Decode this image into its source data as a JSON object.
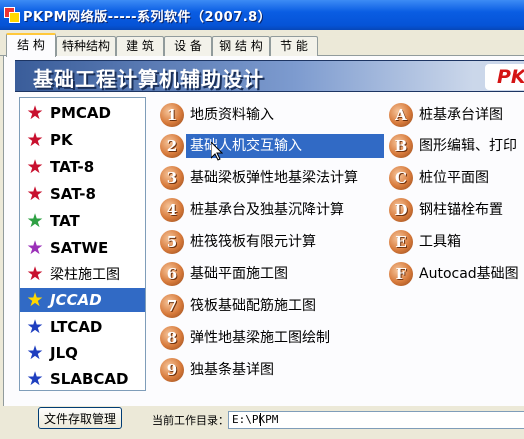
{
  "window": {
    "title": "PKPM网络版-----系列软件（2007.8）"
  },
  "tabs": [
    {
      "label": "结 构",
      "active": true
    },
    {
      "label": "特种结构",
      "active": false
    },
    {
      "label": "建 筑",
      "active": false
    },
    {
      "label": "设 备",
      "active": false
    },
    {
      "label": "钢 结 构",
      "active": false
    },
    {
      "label": "节 能",
      "active": false
    }
  ],
  "banner": {
    "title": "基础工程计算机辅助设计",
    "logo": "PKP"
  },
  "modules": [
    {
      "label": "PMCAD",
      "star_color": "#c8102e",
      "active": false
    },
    {
      "label": "PK",
      "star_color": "#c8102e",
      "active": false
    },
    {
      "label": "TAT-8",
      "star_color": "#c8102e",
      "active": false
    },
    {
      "label": "SAT-8",
      "star_color": "#c8102e",
      "active": false
    },
    {
      "label": "TAT",
      "star_color": "#2ea043",
      "active": false
    },
    {
      "label": "SATWE",
      "star_color": "#9b30b8",
      "active": false
    },
    {
      "label": "梁柱施工图",
      "star_color": "#c8102e",
      "active": false
    },
    {
      "label": "JCCAD",
      "star_color": "#ffd800",
      "active": true
    },
    {
      "label": "LTCAD",
      "star_color": "#1f3fbf",
      "active": false
    },
    {
      "label": "JLQ",
      "star_color": "#1f3fbf",
      "active": false
    },
    {
      "label": "SLABCAD",
      "star_color": "#1f3fbf",
      "active": false
    }
  ],
  "menu_left": [
    {
      "badge": "1",
      "label": "地质资料输入",
      "selected": false
    },
    {
      "badge": "2",
      "label": "基础人机交互输入",
      "selected": true
    },
    {
      "badge": "3",
      "label": "基础梁板弹性地基梁法计算",
      "selected": false
    },
    {
      "badge": "4",
      "label": "桩基承台及独基沉降计算",
      "selected": false
    },
    {
      "badge": "5",
      "label": "桩筏筏板有限元计算",
      "selected": false
    },
    {
      "badge": "6",
      "label": "基础平面施工图",
      "selected": false
    },
    {
      "badge": "7",
      "label": "筏板基础配筋施工图",
      "selected": false
    },
    {
      "badge": "8",
      "label": "弹性地基梁施工图绘制",
      "selected": false
    },
    {
      "badge": "9",
      "label": "独基条基详图",
      "selected": false
    }
  ],
  "menu_right": [
    {
      "badge": "A",
      "label": "桩基承台详图"
    },
    {
      "badge": "B",
      "label": "图形编辑、打印"
    },
    {
      "badge": "C",
      "label": "桩位平面图"
    },
    {
      "badge": "D",
      "label": "钢柱锚栓布置"
    },
    {
      "badge": "E",
      "label": "工具箱"
    },
    {
      "badge": "F",
      "label": "Autocad基础图"
    }
  ],
  "footer": {
    "file_button": "文件存取管理",
    "workdir_label": "当前工作目录：",
    "workdir_value": "E:\\PKPM"
  }
}
